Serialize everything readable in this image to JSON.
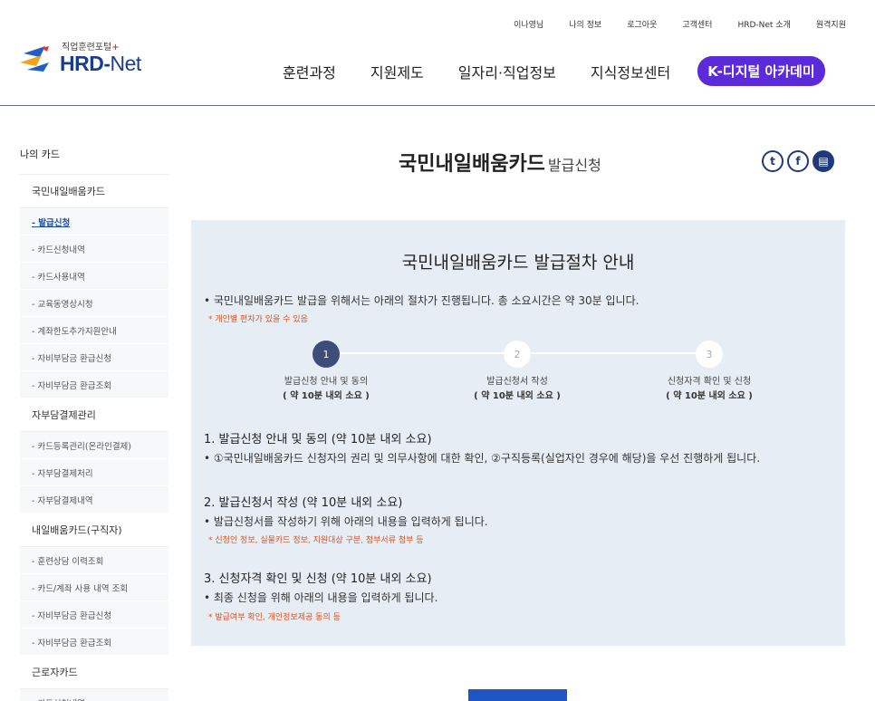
{
  "util_nav": [
    "이나영님",
    "나의 정보",
    "로그아웃",
    "고객센터",
    "HRD-Net 소개",
    "원격지원"
  ],
  "logo": {
    "sub": "직업훈련포털",
    "plus": "+",
    "main": "HRD",
    "dash": "-",
    "net": "Net"
  },
  "gnb": [
    "훈련과정",
    "지원제도",
    "일자리·직업정보",
    "지식정보센터"
  ],
  "gnb_highlight": "K-디지털 아카데미",
  "sidebar": {
    "title": "나의 카드",
    "groups": [
      {
        "label": "국민내일배움카드",
        "items": [
          "- 발급신청",
          "- 카드신청내역",
          "- 카드사용내역",
          "- 교육동영상시청",
          "- 계좌한도추가지원안내",
          "- 자비부담금 환급신청",
          "- 자비부담금 환급조회"
        ]
      },
      {
        "label": "자부담결제관리",
        "items": [
          "- 카드등록관리(온라인결제)",
          "- 자부담결제처리",
          "- 자부담결제내역"
        ]
      },
      {
        "label": "내일배움카드(구직자)",
        "items": [
          "- 훈련상담 이력조회",
          "- 카드/계좌 사용 내역 조회",
          "- 자비부담금 환급신청",
          "- 자비부담금 환급조회"
        ]
      },
      {
        "label": "근로자카드",
        "items": [
          "- 카드신청내역"
        ]
      }
    ]
  },
  "page": {
    "title": "국민내일배움카드",
    "title_sub": "발급신청"
  },
  "share": {
    "twitter": "t",
    "facebook": "f",
    "print": "▤"
  },
  "box": {
    "title": "국민내일배움카드 발급절차 안내",
    "intro": "• 국민내일배움카드 발급을 위해서는 아래의 절차가 진행됩니다. 총 소요시간은 약 30분 입니다.",
    "intro_note": "* 개인별 편차가 있을 수 있음",
    "steps": [
      {
        "num": "1",
        "label": "발급신청 안내 및 동의",
        "time": "( 약 10분 내외 소요 )"
      },
      {
        "num": "2",
        "label": "발급신청서 작성",
        "time": "( 약 10분 내외 소요 )"
      },
      {
        "num": "3",
        "label": "신청자격 확인 및 신청",
        "time": "( 약 10분 내외 소요 )"
      }
    ],
    "sections": [
      {
        "title": "1. 발급신청 안내 및 동의 (약 10분 내외 소요)",
        "desc": "• ①국민내일배움카드 신청자의 권리 및 의무사항에 대한 확인, ②구직등록(실업자인 경우에 해당)을 우선 진행하게 됩니다.",
        "note": ""
      },
      {
        "title": "2. 발급신청서 작성 (약 10분 내외 소요)",
        "desc": "• 발급신청서를 작성하기 위해 아래의 내용을 입력하게 됩니다.",
        "note": "* 신청인 정보, 실물카드 정보, 지원대상 구분, 첨부서류 첨부 등"
      },
      {
        "title": "3. 신청자격 확인 및 신청 (약 10분 내외 소요)",
        "desc": "• 최종 신청을 위해 아래의 내용을 입력하게 됩니다.",
        "note": "* 발급여부 확인, 개인정보제공 동의 등"
      }
    ]
  },
  "colors": {
    "brand_blue": "#1a3d8f",
    "accent_purple": "#5b2bd9",
    "note_orange": "#e2501e",
    "box_bg": "#e6edf5",
    "step_active": "#3c4d77",
    "button_blue": "#1e56c5"
  }
}
